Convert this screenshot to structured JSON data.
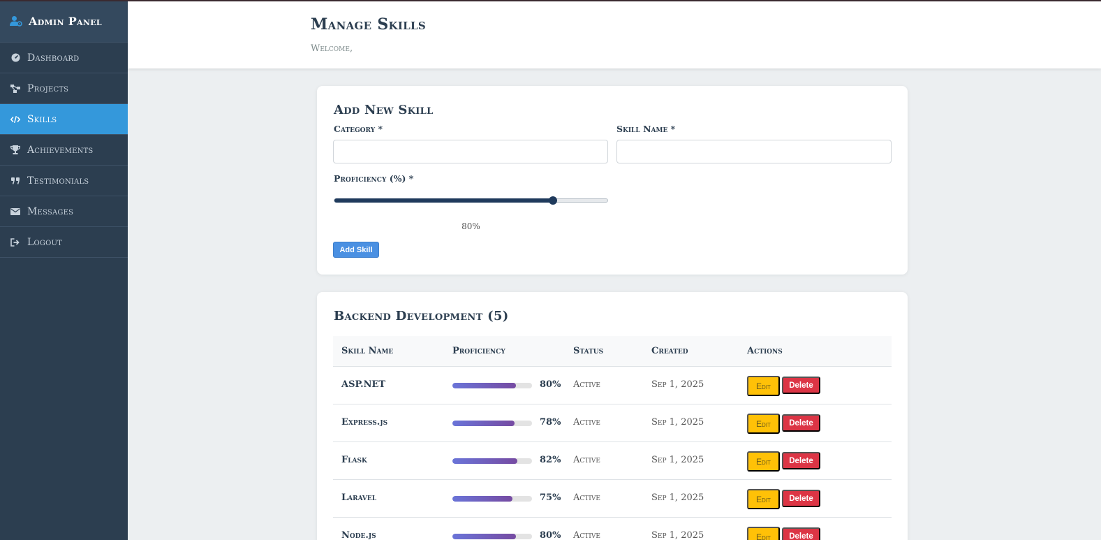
{
  "sidebar": {
    "brand": "Admin Panel",
    "brand_icon": "user-gear-icon",
    "items": [
      {
        "label": "Dashboard",
        "icon": "gauge-icon",
        "active": false
      },
      {
        "label": "Projects",
        "icon": "project-diagram-icon",
        "active": false
      },
      {
        "label": "Skills",
        "icon": "code-icon",
        "active": true
      },
      {
        "label": "Achievements",
        "icon": "trophy-icon",
        "active": false
      },
      {
        "label": "Testimonials",
        "icon": "quote-icon",
        "active": false
      },
      {
        "label": "Messages",
        "icon": "envelope-icon",
        "active": false
      },
      {
        "label": "Logout",
        "icon": "sign-out-icon",
        "active": false
      }
    ]
  },
  "header": {
    "title": "Manage Skills",
    "welcome": "Welcome,"
  },
  "form": {
    "title": "Add New Skill",
    "category_label": "Category *",
    "category_value": "",
    "skill_name_label": "Skill Name *",
    "skill_name_value": "",
    "proficiency_label": "Proficiency (%) *",
    "proficiency_value": 80,
    "proficiency_display": "80%",
    "submit_label": "Add Skill"
  },
  "table": {
    "title": "Backend Development (5)",
    "headers": {
      "name": "Skill Name",
      "proficiency": "Proficiency",
      "status": "Status",
      "created": "Created",
      "actions": "Actions"
    },
    "edit_label": "Edit",
    "delete_label": "Delete",
    "rows": [
      {
        "name": "ASP.NET",
        "proficiency": 80,
        "pct": "80%",
        "status": "Active",
        "created": "Sep 1, 2025"
      },
      {
        "name": "Express.js",
        "proficiency": 78,
        "pct": "78%",
        "status": "Active",
        "created": "Sep 1, 2025"
      },
      {
        "name": "Flask",
        "proficiency": 82,
        "pct": "82%",
        "status": "Active",
        "created": "Sep 1, 2025"
      },
      {
        "name": "Laravel",
        "proficiency": 75,
        "pct": "75%",
        "status": "Active",
        "created": "Sep 1, 2025"
      },
      {
        "name": "Node.js",
        "proficiency": 80,
        "pct": "80%",
        "status": "Active",
        "created": "Sep 1, 2025"
      }
    ]
  },
  "colors": {
    "sidebar_bg": "#2c3e50",
    "active_item": "#3498db",
    "slider": "#1f3a5c",
    "add_button": "#4a90e2",
    "edit_button": "#ffc107",
    "delete_button": "#dc3545"
  }
}
